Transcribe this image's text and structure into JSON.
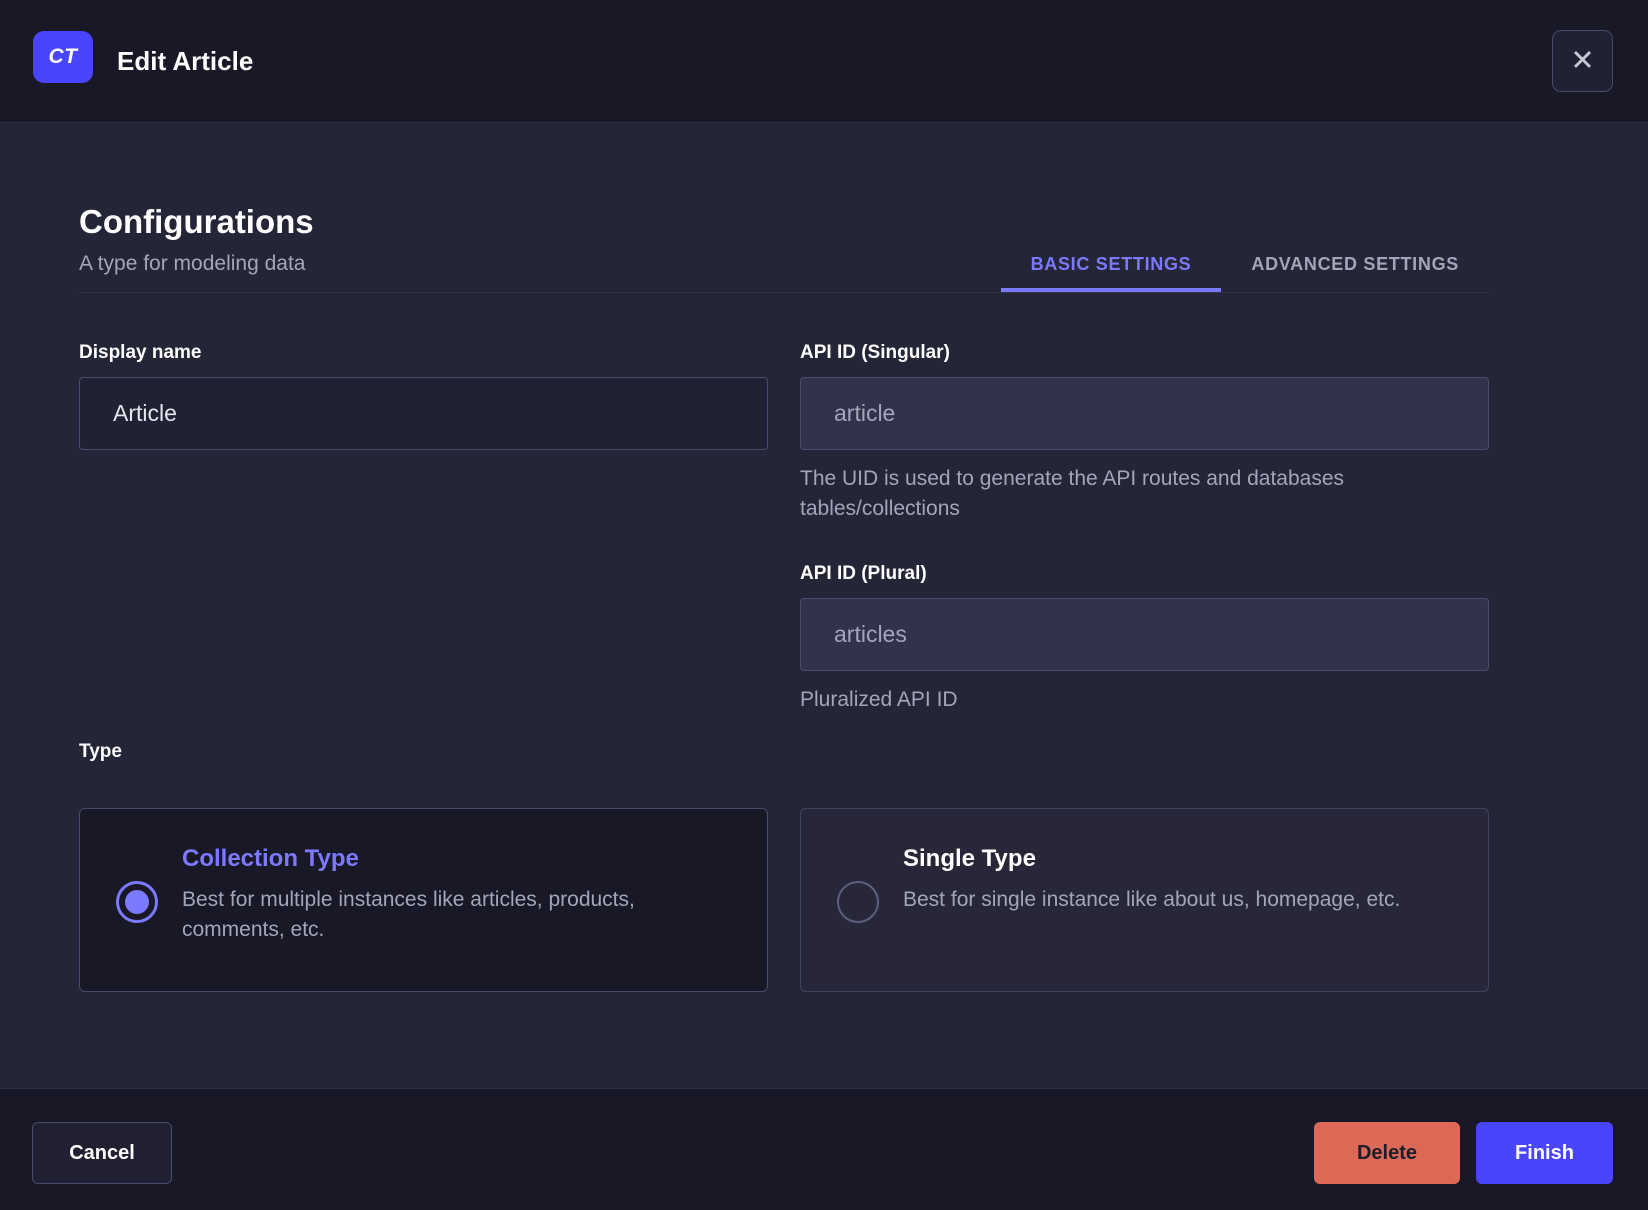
{
  "header": {
    "badge": "CT",
    "title": "Edit Article",
    "close_icon": "✕"
  },
  "configurations": {
    "title": "Configurations",
    "subtitle": "A type for modeling data",
    "tabs": [
      {
        "label": "BASIC SETTINGS",
        "active": true
      },
      {
        "label": "ADVANCED SETTINGS",
        "active": false
      }
    ]
  },
  "form": {
    "display_name": {
      "label": "Display name",
      "value": "Article"
    },
    "api_id_singular": {
      "label": "API ID (Singular)",
      "placeholder": "article",
      "hint": "The UID is used to generate the API routes and databases tables/collections"
    },
    "api_id_plural": {
      "label": "API ID (Plural)",
      "placeholder": "articles",
      "hint": "Pluralized API ID"
    },
    "type": {
      "label": "Type",
      "options": [
        {
          "title": "Collection Type",
          "description": "Best for multiple instances like articles, products, comments, etc.",
          "selected": true
        },
        {
          "title": "Single Type",
          "description": "Best for single instance like about us, homepage, etc.",
          "selected": false
        }
      ]
    }
  },
  "footer": {
    "cancel": "Cancel",
    "delete": "Delete",
    "finish": "Finish"
  },
  "colors": {
    "primary": "#4945ff",
    "primary_light": "#7b79ff",
    "danger": "#dc6955",
    "body_background": "#252538",
    "header_background": "#181826",
    "input_fill": "#32324d",
    "muted_text": "#a5a5ba"
  }
}
